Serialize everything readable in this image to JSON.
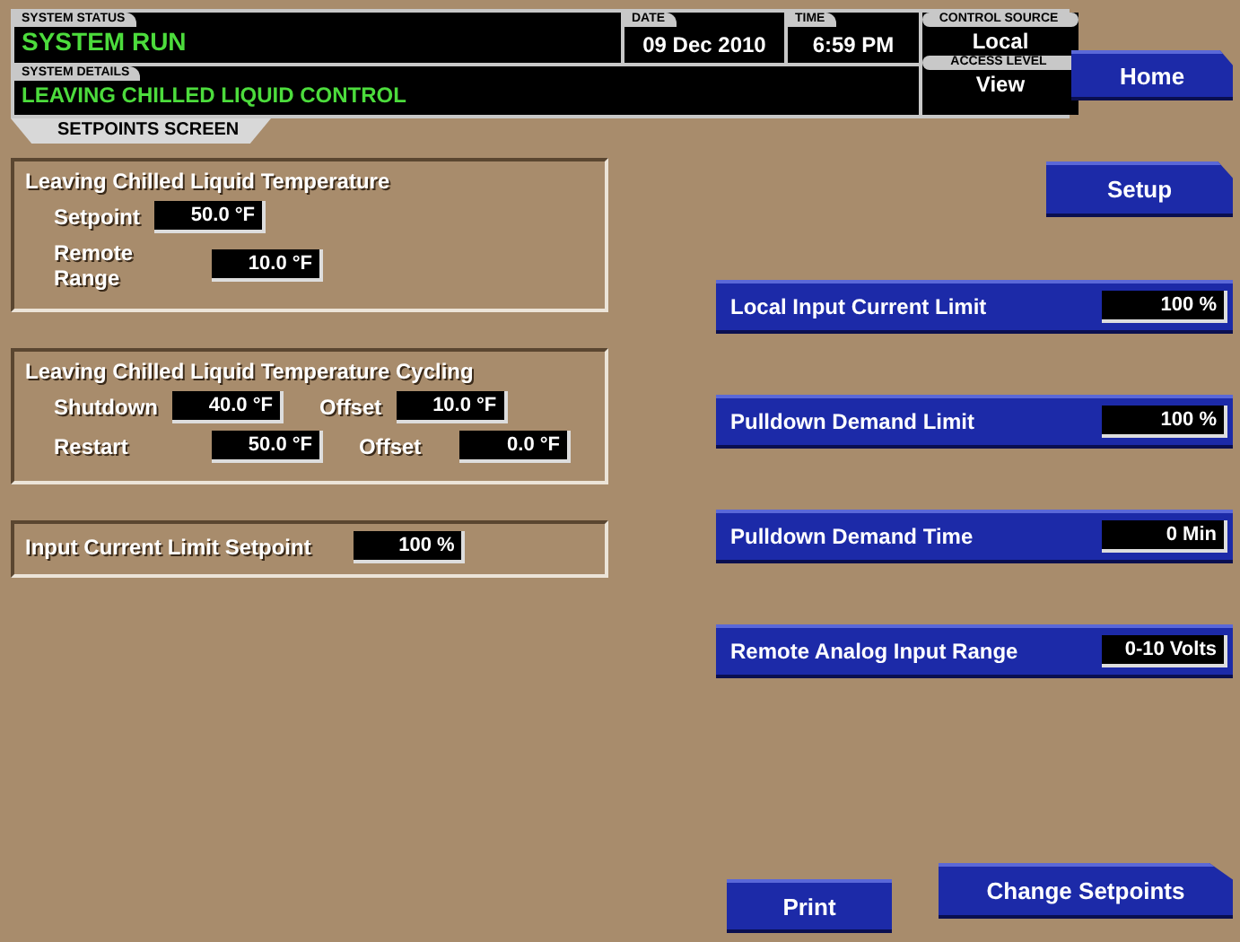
{
  "header": {
    "system_status": {
      "label": "SYSTEM STATUS",
      "value": "SYSTEM RUN"
    },
    "system_details": {
      "label": "SYSTEM DETAILS",
      "value": "LEAVING CHILLED LIQUID CONTROL"
    },
    "date": {
      "label": "DATE",
      "value": "09 Dec 2010"
    },
    "time": {
      "label": "TIME",
      "value": "6:59 PM"
    },
    "control_source": {
      "label": "CONTROL SOURCE",
      "value": "Local"
    },
    "access_level": {
      "label": "ACCESS LEVEL",
      "value": "View"
    }
  },
  "home_button": "Home",
  "screen_tab": "SETPOINTS SCREEN",
  "panels": [
    {
      "kind": "group",
      "title": "Leaving Chilled Liquid Temperature",
      "rows": [
        [
          {
            "label": "Setpoint",
            "value": "50.0 °F"
          }
        ],
        [
          {
            "label": "Remote Range",
            "value": "10.0 °F"
          }
        ]
      ]
    },
    {
      "kind": "group",
      "title": "Leaving Chilled Liquid Temperature Cycling",
      "rows": [
        [
          {
            "label": "Shutdown",
            "value": "40.0 °F"
          },
          {
            "label": "Offset",
            "value": "10.0 °F"
          }
        ],
        [
          {
            "label": "Restart",
            "value": "50.0 °F"
          },
          {
            "label": "Offset",
            "value": "0.0 °F"
          }
        ]
      ]
    },
    {
      "kind": "single",
      "title": "Input Current Limit Setpoint",
      "value": "100 %"
    }
  ],
  "setup_button": "Setup",
  "settings": [
    {
      "label": "Local Input Current Limit",
      "value": "100 %"
    },
    {
      "label": "Pulldown Demand Limit",
      "value": "100 %"
    },
    {
      "label": "Pulldown Demand Time",
      "value": "0 Min"
    },
    {
      "label": "Remote Analog Input Range",
      "value": "0-10 Volts"
    }
  ],
  "print_button": "Print",
  "change_button": "Change Setpoints"
}
